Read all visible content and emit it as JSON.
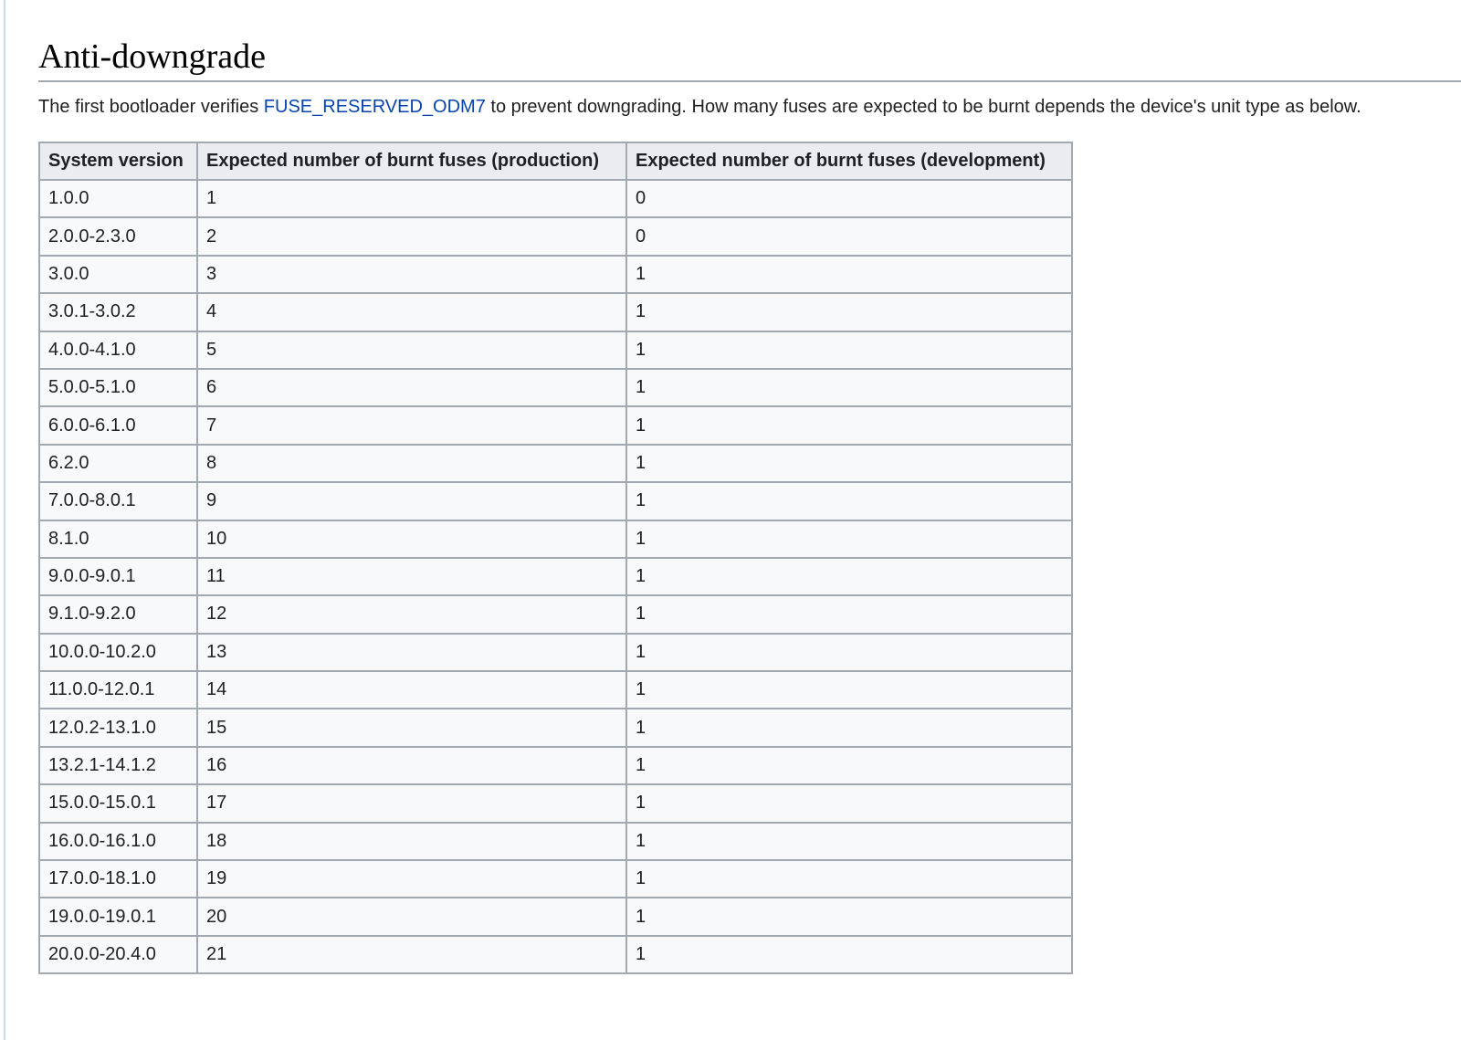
{
  "section": {
    "title": "Anti-downgrade",
    "intro_before": "The first bootloader verifies ",
    "intro_link": "FUSE_RESERVED_ODM7",
    "intro_after": " to prevent downgrading. How many fuses are expected to be burnt depends the device's unit type as below."
  },
  "table": {
    "headers": [
      "System version",
      "Expected number of burnt fuses (production)",
      "Expected number of burnt fuses (development)"
    ],
    "rows": [
      [
        "1.0.0",
        "1",
        "0"
      ],
      [
        "2.0.0-2.3.0",
        "2",
        "0"
      ],
      [
        "3.0.0",
        "3",
        "1"
      ],
      [
        "3.0.1-3.0.2",
        "4",
        "1"
      ],
      [
        "4.0.0-4.1.0",
        "5",
        "1"
      ],
      [
        "5.0.0-5.1.0",
        "6",
        "1"
      ],
      [
        "6.0.0-6.1.0",
        "7",
        "1"
      ],
      [
        "6.2.0",
        "8",
        "1"
      ],
      [
        "7.0.0-8.0.1",
        "9",
        "1"
      ],
      [
        "8.1.0",
        "10",
        "1"
      ],
      [
        "9.0.0-9.0.1",
        "11",
        "1"
      ],
      [
        "9.1.0-9.2.0",
        "12",
        "1"
      ],
      [
        "10.0.0-10.2.0",
        "13",
        "1"
      ],
      [
        "11.0.0-12.0.1",
        "14",
        "1"
      ],
      [
        "12.0.2-13.1.0",
        "15",
        "1"
      ],
      [
        "13.2.1-14.1.2",
        "16",
        "1"
      ],
      [
        "15.0.0-15.0.1",
        "17",
        "1"
      ],
      [
        "16.0.0-16.1.0",
        "18",
        "1"
      ],
      [
        "17.0.0-18.1.0",
        "19",
        "1"
      ],
      [
        "19.0.0-19.0.1",
        "20",
        "1"
      ],
      [
        "20.0.0-20.4.0",
        "21",
        "1"
      ]
    ]
  }
}
